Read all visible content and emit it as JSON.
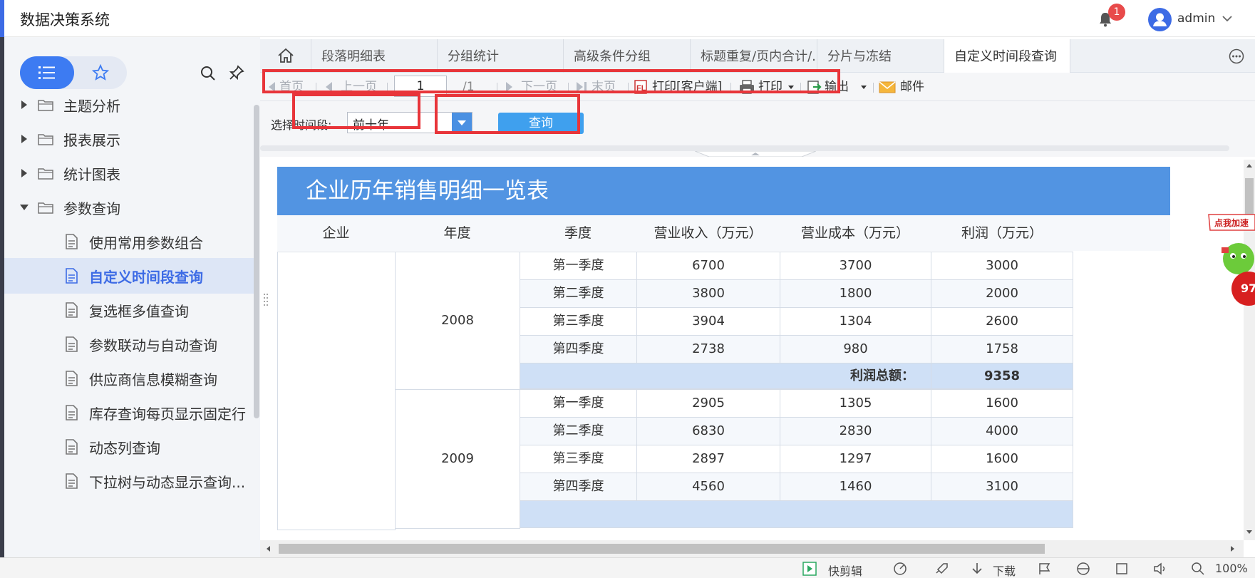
{
  "header": {
    "app_title": "数据决策系统",
    "notification_count": "1",
    "username": "admin"
  },
  "sidebar": {
    "items": [
      {
        "label": "主题分析",
        "type": "folder",
        "expanded": false
      },
      {
        "label": "报表展示",
        "type": "folder",
        "expanded": false
      },
      {
        "label": "统计图表",
        "type": "folder",
        "expanded": false
      },
      {
        "label": "参数查询",
        "type": "folder",
        "expanded": true
      },
      {
        "label": "使用常用参数组合",
        "type": "report"
      },
      {
        "label": "自定义时间段查询",
        "type": "report",
        "selected": true
      },
      {
        "label": "复选框多值查询",
        "type": "report"
      },
      {
        "label": "参数联动与自动查询",
        "type": "report"
      },
      {
        "label": "供应商信息模糊查询",
        "type": "report"
      },
      {
        "label": "库存查询每页显示固定行",
        "type": "report"
      },
      {
        "label": "动态列查询",
        "type": "report"
      },
      {
        "label": "下拉树与动态显示查询...",
        "type": "report"
      }
    ]
  },
  "tabs": [
    {
      "label": "段落明细表"
    },
    {
      "label": "分组统计"
    },
    {
      "label": "高级条件分组"
    },
    {
      "label": "标题重复/页内合计/..."
    },
    {
      "label": "分片与冻结"
    },
    {
      "label": "自定义时间段查询",
      "active": true
    }
  ],
  "toolbar": {
    "first": "首页",
    "prev": "上一页",
    "page_value": "1",
    "page_total": "/1",
    "next": "下一页",
    "last": "末页",
    "print_client": "打印[客户端]",
    "print": "打印",
    "export": "输出",
    "mail": "邮件"
  },
  "params": {
    "label": "选择时间段:",
    "selected": "前十年",
    "query_button": "查询"
  },
  "report": {
    "title": "企业历年销售明细一览表",
    "columns": [
      "企业",
      "年度",
      "季度",
      "营业收入（万元）",
      "营业成本（万元）",
      "利润（万元）"
    ],
    "groups": [
      {
        "year": "2008",
        "rows": [
          {
            "quarter": "第一季度",
            "revenue": "6700",
            "cost": "3700",
            "profit": "3000"
          },
          {
            "quarter": "第二季度",
            "revenue": "3800",
            "cost": "1800",
            "profit": "2000"
          },
          {
            "quarter": "第三季度",
            "revenue": "3904",
            "cost": "1304",
            "profit": "2600"
          },
          {
            "quarter": "第四季度",
            "revenue": "2738",
            "cost": "980",
            "profit": "1758"
          }
        ],
        "total_label": "利润总额：",
        "total": "9358"
      },
      {
        "year": "2009",
        "rows": [
          {
            "quarter": "第一季度",
            "revenue": "2905",
            "cost": "1305",
            "profit": "1600"
          },
          {
            "quarter": "第二季度",
            "revenue": "6830",
            "cost": "2830",
            "profit": "4000"
          },
          {
            "quarter": "第三季度",
            "revenue": "2897",
            "cost": "1297",
            "profit": "1600"
          },
          {
            "quarter": "第四季度",
            "revenue": "4560",
            "cost": "1460",
            "profit": "3100"
          }
        ]
      }
    ]
  },
  "ad_widget": {
    "text": "点我加速",
    "value": "97"
  },
  "statusbar": {
    "clip": "快剪辑",
    "download": "下载",
    "zoom": "100%"
  },
  "colors": {
    "accent": "#3d6be5",
    "title_bar": "#5294e2",
    "highlight_box": "#e8353a",
    "query_button": "#3fa0ee",
    "sum_row": "#cfe0f6"
  }
}
